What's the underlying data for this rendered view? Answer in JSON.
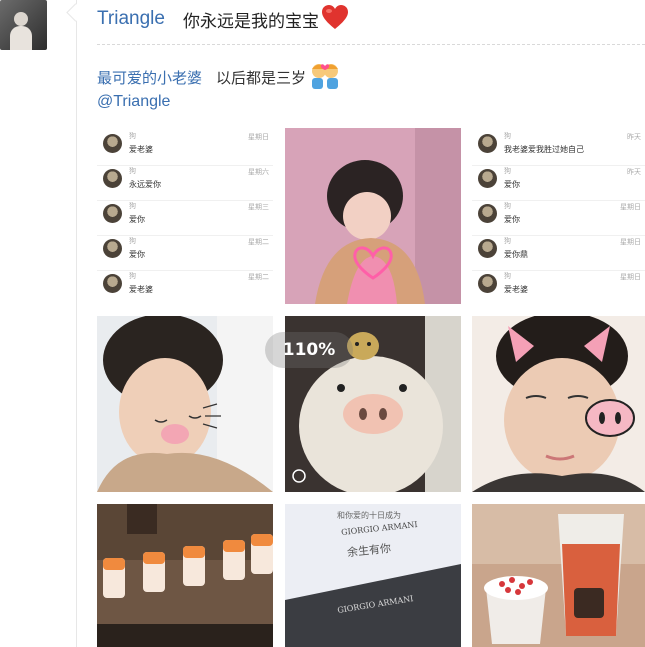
{
  "post": {
    "author": "Triangle",
    "text": "你永远是我的宝宝",
    "emoji": "heart-icon"
  },
  "repost": {
    "author": "最可爱的小老婆",
    "text": "以后都是三岁",
    "emoji": "couple-girls-icon",
    "mention": "@Triangle"
  },
  "zoom_label": "110%",
  "colors": {
    "link": "#3a6fb0",
    "heart": "#e0332e",
    "background": "#ffffff"
  },
  "chat_left": {
    "rows": [
      {
        "name": "狗",
        "message": "爱老婆",
        "time": "星期日"
      },
      {
        "name": "狗",
        "message": "永远爱你",
        "time": "星期六"
      },
      {
        "name": "狗",
        "message": "爱你",
        "time": "星期三"
      },
      {
        "name": "狗",
        "message": "爱你",
        "time": "星期二"
      },
      {
        "name": "狗",
        "message": "爱老婆",
        "time": "星期二"
      }
    ]
  },
  "chat_right": {
    "rows": [
      {
        "name": "狗",
        "message": "我老婆爱我胜过她自己",
        "time": "昨天"
      },
      {
        "name": "狗",
        "message": "爱你",
        "time": "昨天"
      },
      {
        "name": "狗",
        "message": "爱你",
        "time": "星期日"
      },
      {
        "name": "狗",
        "message": "爱你鼎",
        "time": "星期日"
      },
      {
        "name": "狗",
        "message": "爱老婆",
        "time": "星期日"
      }
    ]
  },
  "photos": {
    "box_text_top": "和你爱的十日成为",
    "box_brand": "GIORGIO ARMANI",
    "box_handwriting": "余生有你",
    "box_brand_bottom": "GIORGIO ARMANI"
  }
}
